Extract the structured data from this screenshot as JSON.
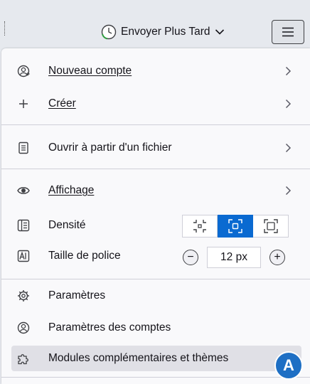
{
  "toolbar": {
    "send_later_label": "Envoyer Plus Tard",
    "send_later_icon": "clock-icon",
    "menu_icon": "hamburger-icon"
  },
  "menu": {
    "items": [
      {
        "label": "Nouveau compte",
        "icon": "new-account-icon",
        "submenu": true
      },
      {
        "label": "Créer",
        "icon": "plus-icon",
        "submenu": true
      },
      {
        "label": "Ouvrir à partir d'un fichier",
        "icon": "file-icon",
        "submenu": true
      },
      {
        "label": "Affichage",
        "icon": "eye-icon",
        "submenu": true
      },
      {
        "label": "Densité",
        "icon": "density-icon"
      },
      {
        "label": "Taille de police",
        "icon": "font-size-icon"
      },
      {
        "label": "Paramètres",
        "icon": "gear-icon"
      },
      {
        "label": "Paramètres des comptes",
        "icon": "account-settings-icon"
      },
      {
        "label": "Modules complémentaires et thèmes",
        "icon": "puzzle-icon"
      }
    ],
    "font_size": {
      "value": "12 px",
      "decrease": "−",
      "increase": "+"
    },
    "density_options": [
      "compact",
      "normal",
      "touch"
    ],
    "density_selected": "normal"
  },
  "annotation": {
    "badge": "A"
  },
  "colors": {
    "accent": "#0a6ad1",
    "badge": "#1e6fc4",
    "hover": "#e0e0e6"
  }
}
